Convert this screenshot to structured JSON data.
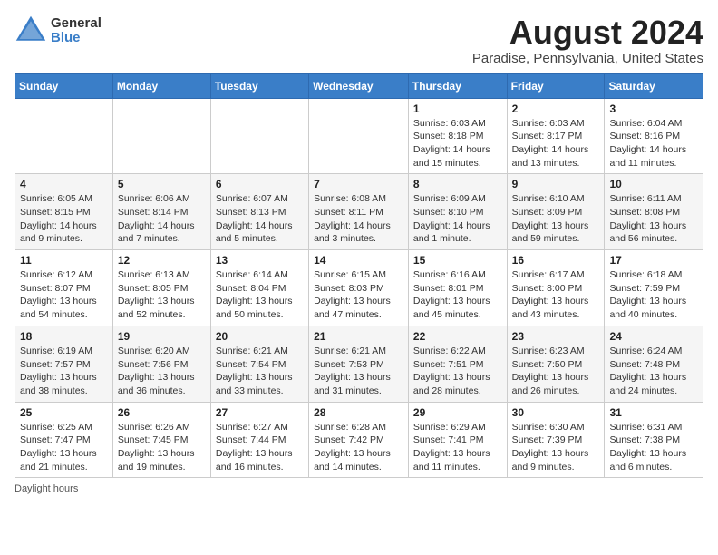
{
  "logo": {
    "general": "General",
    "blue": "Blue"
  },
  "title": "August 2024",
  "subtitle": "Paradise, Pennsylvania, United States",
  "days_of_week": [
    "Sunday",
    "Monday",
    "Tuesday",
    "Wednesday",
    "Thursday",
    "Friday",
    "Saturday"
  ],
  "footer": "Daylight hours",
  "weeks": [
    [
      {
        "day": "",
        "info": ""
      },
      {
        "day": "",
        "info": ""
      },
      {
        "day": "",
        "info": ""
      },
      {
        "day": "",
        "info": ""
      },
      {
        "day": "1",
        "info": "Sunrise: 6:03 AM\nSunset: 8:18 PM\nDaylight: 14 hours and 15 minutes."
      },
      {
        "day": "2",
        "info": "Sunrise: 6:03 AM\nSunset: 8:17 PM\nDaylight: 14 hours and 13 minutes."
      },
      {
        "day": "3",
        "info": "Sunrise: 6:04 AM\nSunset: 8:16 PM\nDaylight: 14 hours and 11 minutes."
      }
    ],
    [
      {
        "day": "4",
        "info": "Sunrise: 6:05 AM\nSunset: 8:15 PM\nDaylight: 14 hours and 9 minutes."
      },
      {
        "day": "5",
        "info": "Sunrise: 6:06 AM\nSunset: 8:14 PM\nDaylight: 14 hours and 7 minutes."
      },
      {
        "day": "6",
        "info": "Sunrise: 6:07 AM\nSunset: 8:13 PM\nDaylight: 14 hours and 5 minutes."
      },
      {
        "day": "7",
        "info": "Sunrise: 6:08 AM\nSunset: 8:11 PM\nDaylight: 14 hours and 3 minutes."
      },
      {
        "day": "8",
        "info": "Sunrise: 6:09 AM\nSunset: 8:10 PM\nDaylight: 14 hours and 1 minute."
      },
      {
        "day": "9",
        "info": "Sunrise: 6:10 AM\nSunset: 8:09 PM\nDaylight: 13 hours and 59 minutes."
      },
      {
        "day": "10",
        "info": "Sunrise: 6:11 AM\nSunset: 8:08 PM\nDaylight: 13 hours and 56 minutes."
      }
    ],
    [
      {
        "day": "11",
        "info": "Sunrise: 6:12 AM\nSunset: 8:07 PM\nDaylight: 13 hours and 54 minutes."
      },
      {
        "day": "12",
        "info": "Sunrise: 6:13 AM\nSunset: 8:05 PM\nDaylight: 13 hours and 52 minutes."
      },
      {
        "day": "13",
        "info": "Sunrise: 6:14 AM\nSunset: 8:04 PM\nDaylight: 13 hours and 50 minutes."
      },
      {
        "day": "14",
        "info": "Sunrise: 6:15 AM\nSunset: 8:03 PM\nDaylight: 13 hours and 47 minutes."
      },
      {
        "day": "15",
        "info": "Sunrise: 6:16 AM\nSunset: 8:01 PM\nDaylight: 13 hours and 45 minutes."
      },
      {
        "day": "16",
        "info": "Sunrise: 6:17 AM\nSunset: 8:00 PM\nDaylight: 13 hours and 43 minutes."
      },
      {
        "day": "17",
        "info": "Sunrise: 6:18 AM\nSunset: 7:59 PM\nDaylight: 13 hours and 40 minutes."
      }
    ],
    [
      {
        "day": "18",
        "info": "Sunrise: 6:19 AM\nSunset: 7:57 PM\nDaylight: 13 hours and 38 minutes."
      },
      {
        "day": "19",
        "info": "Sunrise: 6:20 AM\nSunset: 7:56 PM\nDaylight: 13 hours and 36 minutes."
      },
      {
        "day": "20",
        "info": "Sunrise: 6:21 AM\nSunset: 7:54 PM\nDaylight: 13 hours and 33 minutes."
      },
      {
        "day": "21",
        "info": "Sunrise: 6:21 AM\nSunset: 7:53 PM\nDaylight: 13 hours and 31 minutes."
      },
      {
        "day": "22",
        "info": "Sunrise: 6:22 AM\nSunset: 7:51 PM\nDaylight: 13 hours and 28 minutes."
      },
      {
        "day": "23",
        "info": "Sunrise: 6:23 AM\nSunset: 7:50 PM\nDaylight: 13 hours and 26 minutes."
      },
      {
        "day": "24",
        "info": "Sunrise: 6:24 AM\nSunset: 7:48 PM\nDaylight: 13 hours and 24 minutes."
      }
    ],
    [
      {
        "day": "25",
        "info": "Sunrise: 6:25 AM\nSunset: 7:47 PM\nDaylight: 13 hours and 21 minutes."
      },
      {
        "day": "26",
        "info": "Sunrise: 6:26 AM\nSunset: 7:45 PM\nDaylight: 13 hours and 19 minutes."
      },
      {
        "day": "27",
        "info": "Sunrise: 6:27 AM\nSunset: 7:44 PM\nDaylight: 13 hours and 16 minutes."
      },
      {
        "day": "28",
        "info": "Sunrise: 6:28 AM\nSunset: 7:42 PM\nDaylight: 13 hours and 14 minutes."
      },
      {
        "day": "29",
        "info": "Sunrise: 6:29 AM\nSunset: 7:41 PM\nDaylight: 13 hours and 11 minutes."
      },
      {
        "day": "30",
        "info": "Sunrise: 6:30 AM\nSunset: 7:39 PM\nDaylight: 13 hours and 9 minutes."
      },
      {
        "day": "31",
        "info": "Sunrise: 6:31 AM\nSunset: 7:38 PM\nDaylight: 13 hours and 6 minutes."
      }
    ]
  ]
}
